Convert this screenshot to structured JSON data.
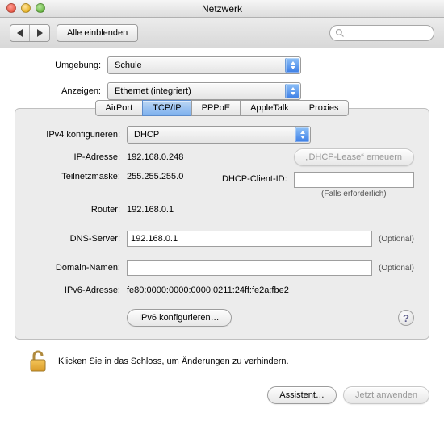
{
  "window": {
    "title": "Netzwerk"
  },
  "toolbar": {
    "show_all": "Alle einblenden"
  },
  "selectors": {
    "location_label": "Umgebung:",
    "location_value": "Schule",
    "show_label": "Anzeigen:",
    "show_value": "Ethernet (integriert)"
  },
  "tabs": {
    "airport": "AirPort",
    "tcpip": "TCP/IP",
    "pppoe": "PPPoE",
    "appletalk": "AppleTalk",
    "proxies": "Proxies"
  },
  "net": {
    "configure_ipv4_label": "IPv4 konfigurieren:",
    "configure_ipv4_value": "DHCP",
    "ip_label": "IP-Adresse:",
    "ip_value": "192.168.0.248",
    "renew_lease": "„DHCP-Lease“ erneuern",
    "subnet_label": "Teilnetzmaske:",
    "subnet_value": "255.255.255.0",
    "dhcp_client_label": "DHCP-Client-ID:",
    "dhcp_client_value": "",
    "dhcp_client_hint": "(Falls erforderlich)",
    "router_label": "Router:",
    "router_value": "192.168.0.1",
    "dns_label": "DNS-Server:",
    "dns_value": "192.168.0.1",
    "optional": "(Optional)",
    "domain_label": "Domain-Namen:",
    "domain_value": "",
    "ipv6addr_label": "IPv6-Adresse:",
    "ipv6addr_value": "fe80:0000:0000:0000:0211:24ff:fe2a:fbe2",
    "ipv6_conf": "IPv6 konfigurieren…"
  },
  "lock": {
    "text": "Klicken Sie in das Schloss, um Änderungen zu verhindern."
  },
  "footer": {
    "assistant": "Assistent…",
    "apply": "Jetzt anwenden"
  }
}
